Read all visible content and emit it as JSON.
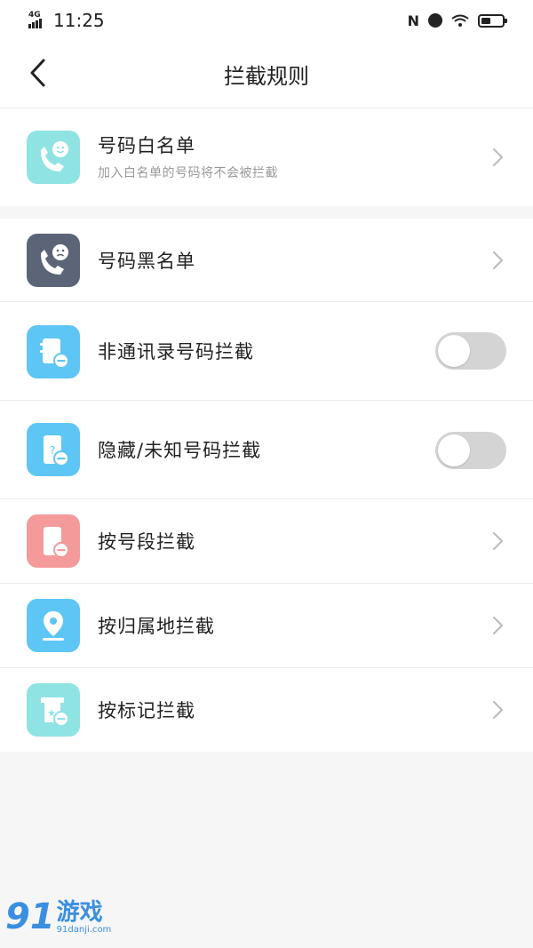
{
  "status_bar": {
    "network": "4G",
    "time": "11:25",
    "nfc": "N"
  },
  "header": {
    "title": "拦截规则"
  },
  "items": [
    {
      "title": "号码白名单",
      "subtitle": "加入白名单的号码将不会被拦截",
      "icon": "phone-smile-icon",
      "icon_color": "#8fe3e3",
      "control": "chevron"
    },
    {
      "title": "号码黑名单",
      "icon": "phone-sad-icon",
      "icon_color": "#5b6577",
      "control": "chevron"
    },
    {
      "title": "非通讯录号码拦截",
      "icon": "contacts-block-icon",
      "icon_color": "#5ec6f5",
      "control": "toggle",
      "on": false
    },
    {
      "title": "隐藏/未知号码拦截",
      "icon": "unknown-phone-icon",
      "icon_color": "#5ec6f5",
      "control": "toggle",
      "on": false
    },
    {
      "title": "按号段拦截",
      "icon": "phone-segment-icon",
      "icon_color": "#f59a9a",
      "control": "chevron"
    },
    {
      "title": "按归属地拦截",
      "icon": "location-icon",
      "icon_color": "#5ec6f5",
      "control": "chevron"
    },
    {
      "title": "按标记拦截",
      "icon": "tag-block-icon",
      "icon_color": "#8fe3e3",
      "control": "chevron"
    }
  ],
  "watermark": {
    "logo": "91",
    "name": "游戏",
    "url": "91danji.com"
  }
}
